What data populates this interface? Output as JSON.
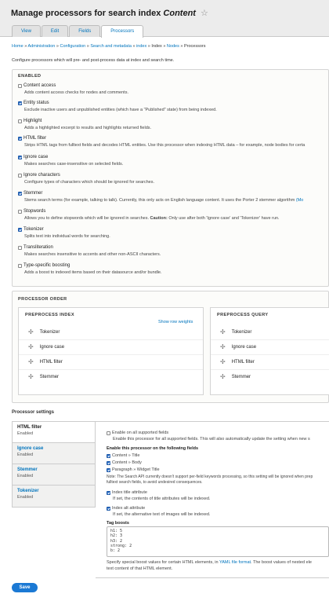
{
  "header": {
    "title_prefix": "Manage processors for search index",
    "title_index": "Content",
    "star": "☆",
    "tabs": [
      "View",
      "Edit",
      "Fields",
      "Processors"
    ]
  },
  "breadcrumb": [
    "Home",
    "Administration",
    "Configuration",
    "Search and metadata",
    "index",
    "Index",
    "Nodes",
    "Processors"
  ],
  "breadcrumb_sep": "»",
  "intro": "Configure processors which will pre- and post-process data at index and search time.",
  "enabled": {
    "legend": "ENABLED",
    "processors": [
      {
        "label": "Content access",
        "checked": false,
        "desc": "Adds content access checks for nodes and comments."
      },
      {
        "label": "Entity status",
        "checked": true,
        "desc": "Exclude inactive users and unpublished entities (which have a \"Published\" state) from being indexed."
      },
      {
        "label": "Highlight",
        "checked": false,
        "desc": "Adds a highlighted excerpt to results and highlights returned fields."
      },
      {
        "label": "HTML filter",
        "checked": true,
        "desc": "Strips HTML tags from fulltext fields and decodes HTML entities. Use this processor when indexing HTML data – for example, node bodies for certa"
      },
      {
        "label": "Ignore case",
        "checked": true,
        "desc": "Makes searches case-insensitive on selected fields."
      },
      {
        "label": "Ignore characters",
        "checked": false,
        "desc": "Configure types of characters which should be ignored for searches."
      },
      {
        "label": "Stemmer",
        "checked": true,
        "desc": "Stems search terms (for example, talking to talk). Currently, this only acts on English language content. It uses the Porter 2 stemmer algorithm",
        "desc_link": "(Mo"
      },
      {
        "label": "Stopwords",
        "checked": false,
        "desc": "Allows you to define stopwords which will be ignored in searches.",
        "desc_bold": "Caution:",
        "desc_after": "Only use after both 'Ignore case' and 'Tokenizer' have run."
      },
      {
        "label": "Tokenizer",
        "checked": true,
        "desc": "Splits text into individual words for searching."
      },
      {
        "label": "Transliteration",
        "checked": false,
        "desc": "Makes searches insensitive to accents and other non-ASCII characters."
      },
      {
        "label": "Type-specific boosting",
        "checked": false,
        "desc": "Adds a boost to indexed items based on their datasource and/or bundle."
      }
    ]
  },
  "order": {
    "legend": "PROCESSOR ORDER",
    "preprocess_index": {
      "title": "PREPROCESS INDEX",
      "weights_link": "Show row weights",
      "items": [
        "Tokenizer",
        "Ignore case",
        "HTML filter",
        "Stemmer"
      ]
    },
    "preprocess_query": {
      "title": "PREPROCESS QUERY",
      "items": [
        "Tokenizer",
        "Ignore case",
        "HTML filter",
        "Stemmer"
      ]
    },
    "drag_glyph": "✢"
  },
  "settings": {
    "title": "Processor settings",
    "tabs": [
      {
        "name": "HTML filter",
        "status": "Enabled"
      },
      {
        "name": "Ignore case",
        "status": "Enabled"
      },
      {
        "name": "Stemmer",
        "status": "Enabled"
      },
      {
        "name": "Tokenizer",
        "status": "Enabled"
      }
    ],
    "panel": {
      "all_fields_label": "Enable on all supported fields",
      "all_fields_desc": "Enable this processor for all supported fields. This will also automatically update the setting when new s",
      "fields_heading": "Enable this processor on the following fields",
      "fields": [
        "Content » Title",
        "Content » Body",
        "Paragraph » Widget Title"
      ],
      "note_line1": "Note: The Search API currently doesn't support per-field keywords processing, so this setting will be ignored when prep",
      "note_line2": "fulltext search fields, to avoid undesired consequences.",
      "title_attr_label": "Index title attribute",
      "title_attr_desc": "If set, the contents of title attributes will be indexed.",
      "alt_attr_label": "Index alt attribute",
      "alt_attr_desc": "If set, the alternative text of images will be indexed.",
      "boosts_label": "Tag boosts",
      "boosts_value": "h1: 5\nh2: 3\nh3: 2\nstrong: 2\nb: 2",
      "boosts_help_a": "Specify special boost values for certain HTML elements, in",
      "boosts_help_link": "YAML file format",
      "boosts_help_b": ". The boost values of nested ele",
      "boosts_help_c": "text content of that HTML element."
    }
  },
  "save_label": "Save"
}
